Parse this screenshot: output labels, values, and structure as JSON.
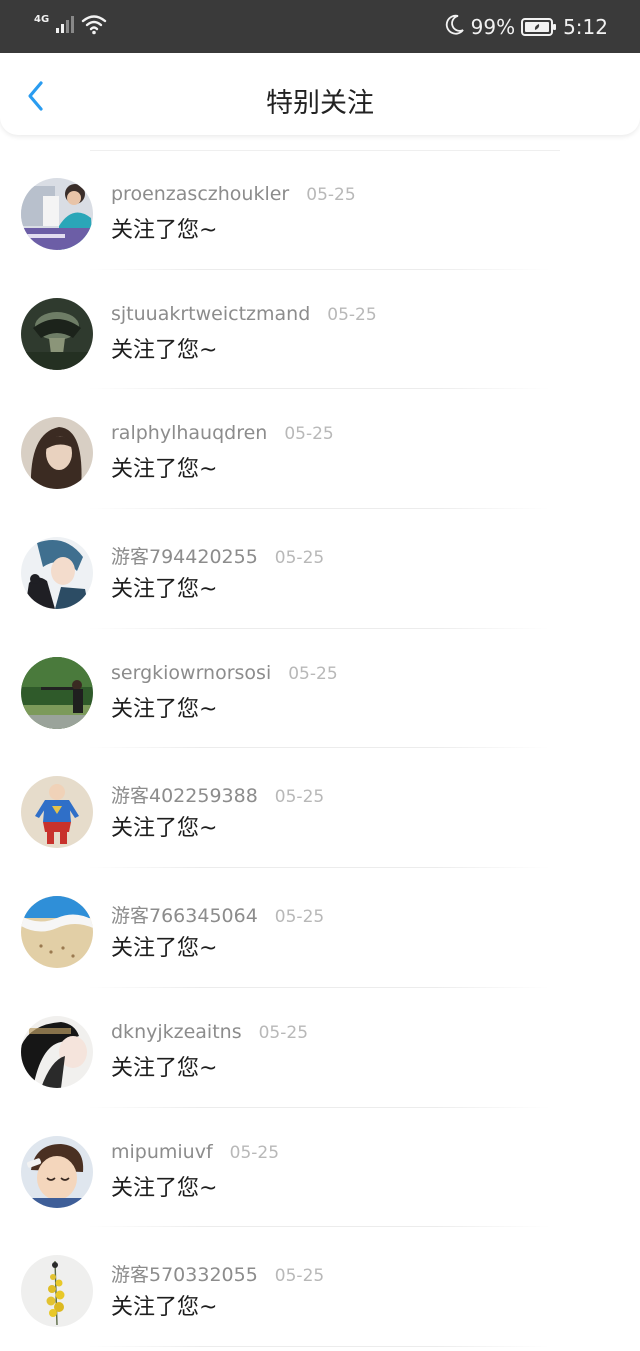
{
  "status_bar": {
    "network": "4G",
    "battery_percent": "99%",
    "time": "5:12",
    "icons": [
      "signal-icon",
      "wifi-icon",
      "moon-icon",
      "battery-icon"
    ]
  },
  "header": {
    "back_icon": "chevron-left-icon",
    "title": "特别关注"
  },
  "colors": {
    "accent": "#2a9cf0",
    "status_bar_bg": "#3a3a3a",
    "username": "#8c8c8c",
    "date": "#b8b8b8",
    "message": "#1e1e1e"
  },
  "notifications": [
    {
      "username": "proenzasczhoukler",
      "date": "05-25",
      "message": "关注了您~"
    },
    {
      "username": "sjtuuakrtweictzmand",
      "date": "05-25",
      "message": "关注了您~"
    },
    {
      "username": "ralphylhauqdren",
      "date": "05-25",
      "message": "关注了您~"
    },
    {
      "username": "游客794420255",
      "date": "05-25",
      "message": "关注了您~"
    },
    {
      "username": "sergkiowrnorsosi",
      "date": "05-25",
      "message": "关注了您~"
    },
    {
      "username": "游客402259388",
      "date": "05-25",
      "message": "关注了您~"
    },
    {
      "username": "游客766345064",
      "date": "05-25",
      "message": "关注了您~"
    },
    {
      "username": "dknyjkzeaitns",
      "date": "05-25",
      "message": "关注了您~"
    },
    {
      "username": "mipumiuvf",
      "date": "05-25",
      "message": "关注了您~"
    },
    {
      "username": "游客570332055",
      "date": "05-25",
      "message": "关注了您~"
    }
  ]
}
